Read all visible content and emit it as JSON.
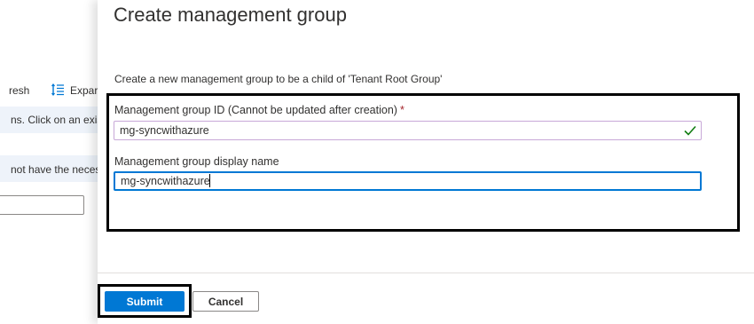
{
  "background": {
    "toolbar": {
      "refresh_label": "resh",
      "expand_label": "Expar"
    },
    "info_text_1": "ns. Click on an exisit",
    "info_text_2": "not have the necess"
  },
  "blade": {
    "title": "Create management group",
    "description": "Create a new management group to be a child of 'Tenant Root Group'",
    "fields": {
      "group_id": {
        "label": "Management group ID (Cannot be updated after creation)",
        "required_mark": "*",
        "value": "mg-syncwithazure"
      },
      "display_name": {
        "label": "Management group display name",
        "value": "mg-syncwithazure"
      }
    },
    "footer": {
      "submit_label": "Submit",
      "cancel_label": "Cancel"
    }
  },
  "colors": {
    "primary": "#0078d4",
    "required": "#a4262c",
    "valid": "#107c10",
    "highlight": "#000000"
  },
  "icons": {
    "expand": "expand-list-icon",
    "valid": "checkmark-icon"
  }
}
